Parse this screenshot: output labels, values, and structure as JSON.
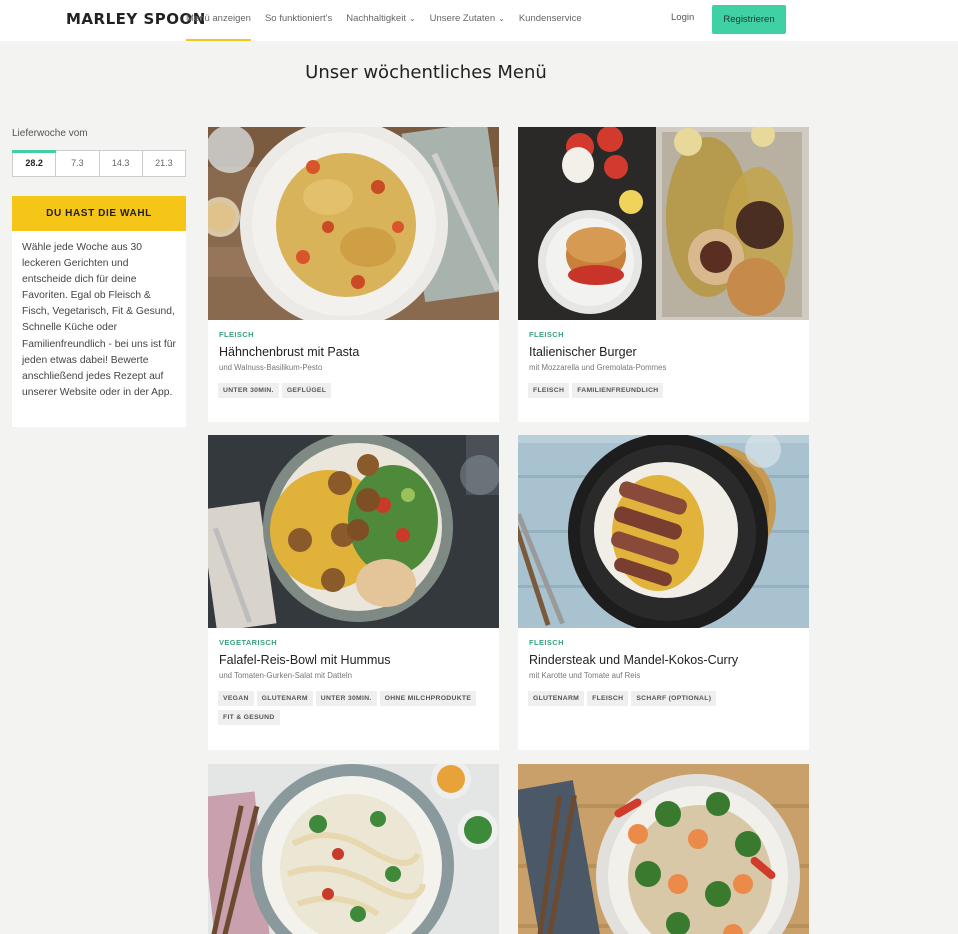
{
  "header": {
    "logo": "MARLEY SPOON",
    "nav": [
      {
        "label": "Menü anzeigen",
        "dropdown": false,
        "active": true
      },
      {
        "label": "So funktioniert's",
        "dropdown": false,
        "active": false
      },
      {
        "label": "Nachhaltigkeit",
        "dropdown": true,
        "active": false
      },
      {
        "label": "Unsere Zutaten",
        "dropdown": true,
        "active": false
      },
      {
        "label": "Kundenservice",
        "dropdown": false,
        "active": false
      }
    ],
    "login": "Login",
    "register": "Registrieren",
    "accent_color": "#3fd0a3",
    "active_underline_color": "#f5c518"
  },
  "page_title": "Unser wöchentliches Menü",
  "sidebar": {
    "week_label": "Lieferwoche vom",
    "weeks": [
      "28.2",
      "7.3",
      "14.3",
      "21.3"
    ],
    "selected_week": "28.2",
    "choice_heading": "DU HAST DIE WAHL",
    "choice_text": "Wähle jede Woche aus 30 leckeren Gerichten und entscheide dich für deine Favoriten. Egal ob Fleisch & Fisch, Vegetarisch, Fit & Gesund, Schnelle Küche oder Familienfreundlich - bei uns ist für jeden etwas dabei! Bewerte anschließend jedes Rezept auf unserer Website oder in der App."
  },
  "recipes": [
    {
      "category": "FLEISCH",
      "title": "Hähnchenbrust mit Pasta",
      "subtitle": "und Walnuss-Basilikum-Pesto",
      "tags": [
        "UNTER 30MIN.",
        "GEFLÜGEL"
      ]
    },
    {
      "category": "FLEISCH",
      "title": "Italienischer Burger",
      "subtitle": "mit Mozzarella und Gremolata-Pommes",
      "tags": [
        "FLEISCH",
        "FAMILIENFREUNDLICH"
      ]
    },
    {
      "category": "VEGETARISCH",
      "title": "Falafel-Reis-Bowl mit Hummus",
      "subtitle": "und Tomaten-Gurken-Salat mit Datteln",
      "tags": [
        "VEGAN",
        "GLUTENARM",
        "UNTER 30MIN.",
        "OHNE MILCHPRODUKTE",
        "FIT & GESUND"
      ]
    },
    {
      "category": "FLEISCH",
      "title": "Rindersteak und Mandel-Kokos-Curry",
      "subtitle": "mit Karotte und Tomate auf Reis",
      "tags": [
        "GLUTENARM",
        "FLEISCH",
        "SCHARF (OPTIONAL)"
      ]
    },
    {
      "category": "",
      "title": "",
      "subtitle": "",
      "tags": []
    },
    {
      "category": "",
      "title": "",
      "subtitle": "",
      "tags": []
    }
  ]
}
